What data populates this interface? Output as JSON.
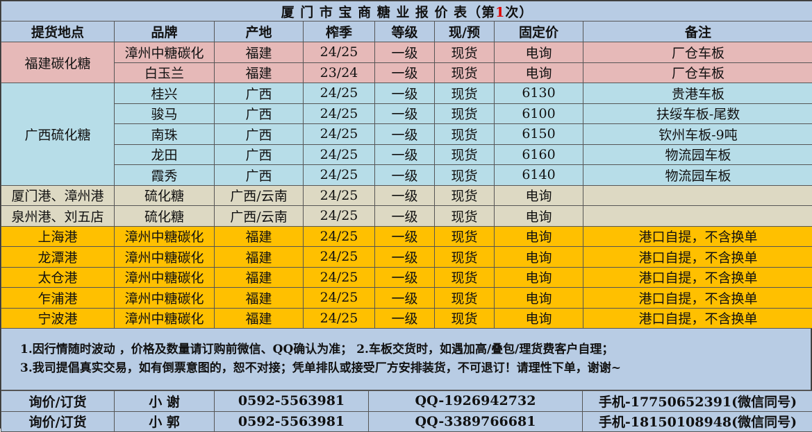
{
  "title": {
    "prefix": "厦 门 市 宝 商 糖 业 报 价 表（第",
    "num": "1",
    "suffix": "次）"
  },
  "headers": [
    "提货地点",
    "品牌",
    "产地",
    "榨季",
    "等级",
    "现/预",
    "固定价",
    "备注"
  ],
  "groups": [
    {
      "location": "福建碳化糖",
      "rows": [
        {
          "brand": "漳州中糖碳化",
          "origin": "福建",
          "season": "24/25",
          "grade": "一级",
          "spot": "现货",
          "price": "电询",
          "note": "厂仓车板"
        },
        {
          "brand": "白玉兰",
          "origin": "福建",
          "season": "23/24",
          "grade": "一级",
          "spot": "现货",
          "price": "电询",
          "note": "厂仓车板"
        }
      ]
    },
    {
      "location": "广西硫化糖",
      "rows": [
        {
          "brand": "桂兴",
          "origin": "广西",
          "season": "24/25",
          "grade": "一级",
          "spot": "现货",
          "price": "6130",
          "note": "贵港车板"
        },
        {
          "brand": "骏马",
          "origin": "广西",
          "season": "24/25",
          "grade": "一级",
          "spot": "现货",
          "price": "6100",
          "note": "扶绥车板-尾数"
        },
        {
          "brand": "南珠",
          "origin": "广西",
          "season": "24/25",
          "grade": "一级",
          "spot": "现货",
          "price": "6150",
          "note": "钦州车板-9吨"
        },
        {
          "brand": "龙田",
          "origin": "广西",
          "season": "24/25",
          "grade": "一级",
          "spot": "现货",
          "price": "6160",
          "note": "物流园车板"
        },
        {
          "brand": "霞秀",
          "origin": "广西",
          "season": "24/25",
          "grade": "一级",
          "spot": "现货",
          "price": "6140",
          "note": "物流园车板"
        }
      ]
    }
  ],
  "port_rows": [
    {
      "location": "厦门港、漳州港",
      "brand": "硫化糖",
      "origin": "广西/云南",
      "season": "24/25",
      "grade": "一级",
      "spot": "现货",
      "price": "电询",
      "note": ""
    },
    {
      "location": "泉州港、刘五店",
      "brand": "硫化糖",
      "origin": "广西/云南",
      "season": "24/25",
      "grade": "一级",
      "spot": "现货",
      "price": "电询",
      "note": ""
    }
  ],
  "dock_rows": [
    {
      "location": "上海港",
      "brand": "漳州中糖碳化",
      "origin": "福建",
      "season": "24/25",
      "grade": "一级",
      "spot": "现货",
      "price": "电询",
      "note": "港口自提，不含换单"
    },
    {
      "location": "龙潭港",
      "brand": "漳州中糖碳化",
      "origin": "福建",
      "season": "24/25",
      "grade": "一级",
      "spot": "现货",
      "price": "电询",
      "note": "港口自提，不含换单"
    },
    {
      "location": "太仓港",
      "brand": "漳州中糖碳化",
      "origin": "福建",
      "season": "24/25",
      "grade": "一级",
      "spot": "现货",
      "price": "电询",
      "note": "港口自提，不含换单"
    },
    {
      "location": "乍浦港",
      "brand": "漳州中糖碳化",
      "origin": "福建",
      "season": "24/25",
      "grade": "一级",
      "spot": "现货",
      "price": "电询",
      "note": "港口自提，不含换单"
    },
    {
      "location": "宁波港",
      "brand": "漳州中糖碳化",
      "origin": "福建",
      "season": "24/25",
      "grade": "一级",
      "spot": "现货",
      "price": "电询",
      "note": "港口自提，不含换单"
    }
  ],
  "notes": [
    "1.因行情随时波动 ，价格及数量请订购前微信、QQ确认为准；  2.车板交货时，如遇加高/叠包/理货费客户自理；",
    "3.我司提倡真实交易，如有倒票意图的，恕不对接；凭单排队或接受厂方安排装货，不可退订！请理性下单，谢谢~"
  ],
  "contacts": [
    {
      "label": "询价/订货",
      "name": "小 谢",
      "phone": "0592-5563981",
      "qq": "QQ-1926942732",
      "mobile": "手机-17750652391(微信同号)"
    },
    {
      "label": "询价/订货",
      "name": "小 郭",
      "phone": "0592-5563981",
      "qq": "QQ-3389766681",
      "mobile": "手机-18150108948(微信同号)"
    }
  ],
  "colors": {
    "header": "#b8cce4",
    "fujian": "#e6b9b8",
    "guangxi": "#b7dde8",
    "port": "#ddd9c3",
    "dock": "#ffc000",
    "title_number": "#e00000"
  }
}
